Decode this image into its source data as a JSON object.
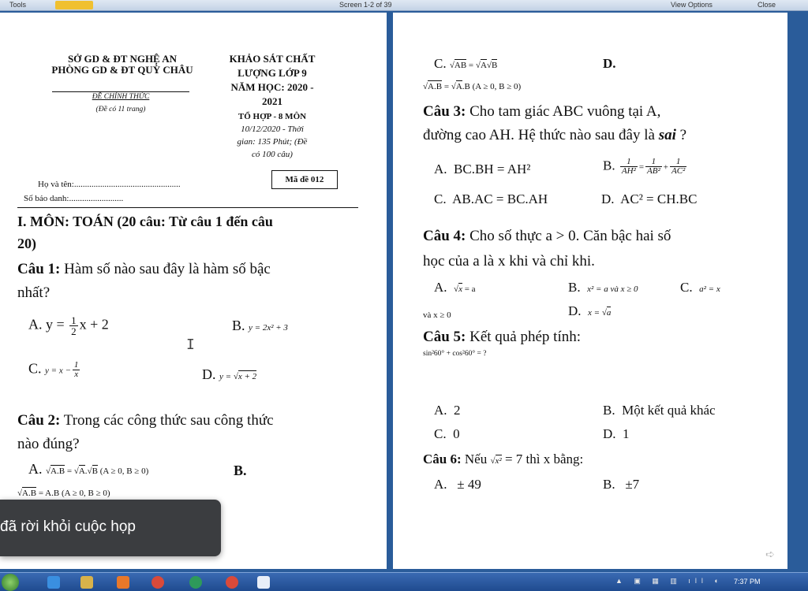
{
  "toolbar": {
    "tools": "Tools",
    "screen": "Screen 1-2 of 39",
    "view_options": "View Options",
    "close": "Close"
  },
  "header": {
    "so": "SỞ GD & ĐT NGHỆ AN",
    "phong": "PHÒNG GD & ĐT QUỲ CHÂU",
    "de_chinh_thuc": "ĐỀ CHÍNH THỨC",
    "so_trang": "(Đề có 11 trang)",
    "khao_sat": "KHẢO SÁT CHẤT",
    "luong_lop": "LƯỢNG LỚP 9",
    "nam_hoc": "NĂM HỌC:  2020 -",
    "nam": "2021",
    "to_hop": "TỔ HỢP - 8 MÔN",
    "ngay": "10/12/2020 - Thời",
    "gian": "gian: 135 Phút; (Đề",
    "co_cau": "có 100 câu)",
    "ho_ten": "Họ và tên:.................................................",
    "so_bao_danh": "Số báo danh:.........................",
    "ma_de": "Mã đề 012"
  },
  "left": {
    "section": "I. MÔN: TOÁN (20 câu: Từ câu 1 đến câu",
    "section2": "20)",
    "q1_label": "Câu 1:",
    "q1_text": " Hàm số nào sau đây là hàm số bậc",
    "q1_text2": "nhất?",
    "q1_A_label": "A.",
    "q1_A_pre": "y = ",
    "q1_A_num": "1",
    "q1_A_den": "2",
    "q1_A_post": "x + 2",
    "q1_B_label": "B.",
    "q1_B_text": "y = 2x² + 3",
    "q1_C_label": "C.",
    "q1_C_pre": "y = x −",
    "q1_C_num": "1",
    "q1_C_den": "x",
    "q1_D_label": "D.",
    "q1_D_pre": "y = ",
    "q1_D_rad": "x + 2",
    "q2_label": "Câu 2:",
    "q2_text": " Trong các công thức sau công thức",
    "q2_text2": "nào đúng?",
    "q2_A_label": "A.",
    "q2_A_rad1": "A.B",
    "q2_A_eq": " = ",
    "q2_A_rad2": "A",
    "q2_A_dot": ".",
    "q2_A_rad3": "B",
    "q2_A_cond": " (A ≥ 0, B ≥ 0)",
    "q2_B_label": "B.",
    "q2_B_rad": "A.B",
    "q2_B_text": " = A.B (A ≥ 0, B ≥ 0)"
  },
  "right": {
    "q2_C_label": "C.",
    "q2_C_rad1": "AB",
    "q2_C_eq": " = ",
    "q2_C_rad2": "A",
    "q2_C_rad3": "B",
    "q2_D_label": "D.",
    "q2_D_rad1": "A.B",
    "q2_D_eq": " = ",
    "q2_D_rad2": "A",
    "q2_D_text": ".B (A ≥ 0, B ≥ 0)",
    "q3_label": "Câu 3:",
    "q3_text": " Cho tam giác ABC vuông tại A,",
    "q3_text2": "đường cao AH. Hệ thức nào sau đây là ",
    "q3_sai": "sai",
    "q3_q": " ?",
    "q3_A_label": "A.",
    "q3_A_text": "BC.BH = AH²",
    "q3_B_label": "B.",
    "q3_B_f1n": "1",
    "q3_B_f1d": "AH²",
    "q3_B_eq": "=",
    "q3_B_f2n": "1",
    "q3_B_f2d": "AB²",
    "q3_B_plus": "+",
    "q3_B_f3n": "1",
    "q3_B_f3d": "AC²",
    "q3_C_label": "C.",
    "q3_C_text": "AB.AC = BC.AH",
    "q3_D_label": "D.",
    "q3_D_text": "AC² = CH.BC",
    "q4_label": "Câu 4:",
    "q4_text": " Cho số thực a > 0. Căn bậc hai số",
    "q4_text2": "học của a là x khi và chỉ khi.",
    "q4_A_label": "A.",
    "q4_A_rad": "x",
    "q4_A_text": " = a",
    "q4_A_text2": "và  x ≥ 0",
    "q4_B_label": "B.",
    "q4_B_text": "x² = a và x ≥ 0",
    "q4_C_label": "C.",
    "q4_C_text": "a² = x",
    "q4_D_label": "D.",
    "q4_D_pre": "x = ",
    "q4_D_rad": "a",
    "q5_label": "Câu 5:",
    "q5_text": " Kết quả phép tính:",
    "q5_expr": "sin²60° + cos²60° = ?",
    "q5_A_label": "A.",
    "q5_A_text": "2",
    "q5_B_label": "B.",
    "q5_B_text": "Một kết quả khác",
    "q5_C_label": "C.",
    "q5_C_text": "0",
    "q5_D_label": "D.",
    "q5_D_text": "1",
    "q6_label": "Câu 6:",
    "q6_pre": " Nếu ",
    "q6_rad": "x²",
    "q6_post": " = 7 thì x bằng:",
    "q6_A_label": "A.",
    "q6_A_text": "± 49",
    "q6_B_label": "B.",
    "q6_B_text": "±7"
  },
  "toast": {
    "text": "đã rời khỏi cuộc họp"
  },
  "taskbar": {
    "clock": "7:37 PM"
  }
}
